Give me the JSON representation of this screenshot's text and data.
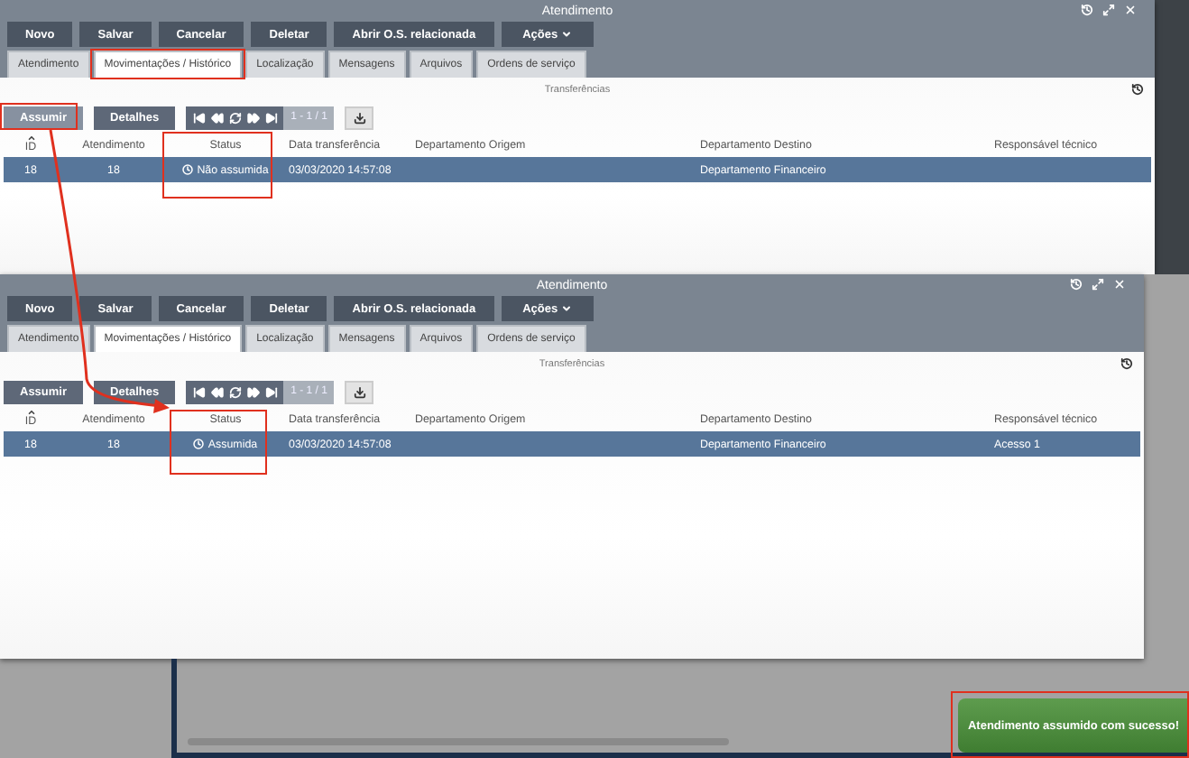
{
  "windows": [
    {
      "title": "Atendimento",
      "toolbar": [
        {
          "label": "Novo"
        },
        {
          "label": "Salvar"
        },
        {
          "label": "Cancelar"
        },
        {
          "label": "Deletar"
        },
        {
          "label": "Abrir O.S. relacionada"
        },
        {
          "label": "Ações",
          "dropdown": true
        }
      ],
      "tabs": [
        {
          "label": "Atendimento",
          "selected": false
        },
        {
          "label": "Movimentações / Histórico",
          "selected": true
        },
        {
          "label": "Localização",
          "selected": false
        },
        {
          "label": "Mensagens",
          "selected": false
        },
        {
          "label": "Arquivos",
          "selected": false
        },
        {
          "label": "Ordens de serviço",
          "selected": false
        }
      ],
      "section_title": "Transferências",
      "actions": [
        {
          "label": "Assumir",
          "hover": true
        },
        {
          "label": "Detalhes",
          "hover": false
        }
      ],
      "pager": "1 - 1 / 1",
      "columns": [
        "ID",
        "Atendimento",
        "Status",
        "Data transferência",
        "Departamento Origem",
        "Departamento Destino",
        "Responsável técnico"
      ],
      "rows": [
        {
          "selected": true,
          "cells": [
            "18",
            "18",
            "Não assumida",
            "03/03/2020 14:57:08",
            "",
            "Departamento Financeiro",
            ""
          ]
        }
      ]
    },
    {
      "title": "Atendimento",
      "toolbar": [
        {
          "label": "Novo"
        },
        {
          "label": "Salvar"
        },
        {
          "label": "Cancelar"
        },
        {
          "label": "Deletar"
        },
        {
          "label": "Abrir O.S. relacionada"
        },
        {
          "label": "Ações",
          "dropdown": true
        }
      ],
      "tabs": [
        {
          "label": "Atendimento",
          "selected": false
        },
        {
          "label": "Movimentações / Histórico",
          "selected": true
        },
        {
          "label": "Localização",
          "selected": false
        },
        {
          "label": "Mensagens",
          "selected": false
        },
        {
          "label": "Arquivos",
          "selected": false
        },
        {
          "label": "Ordens de serviço",
          "selected": false
        }
      ],
      "section_title": "Transferências",
      "actions": [
        {
          "label": "Assumir",
          "hover": false
        },
        {
          "label": "Detalhes",
          "hover": false
        }
      ],
      "pager": "1 - 1 / 1",
      "columns": [
        "ID",
        "Atendimento",
        "Status",
        "Data transferência",
        "Departamento Origem",
        "Departamento Destino",
        "Responsável técnico"
      ],
      "rows": [
        {
          "selected": true,
          "cells": [
            "18",
            "18",
            "Assumida",
            "03/03/2020 14:57:08",
            "",
            "Departamento Financeiro",
            "Acesso 1"
          ]
        }
      ]
    }
  ],
  "toast": "Atendimento assumido com sucesso!"
}
